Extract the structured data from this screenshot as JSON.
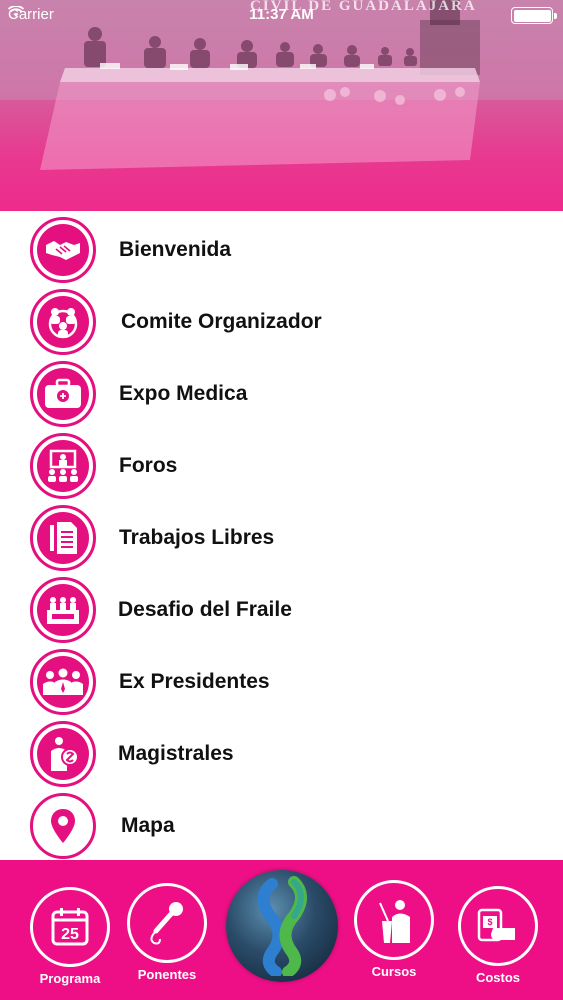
{
  "status_bar": {
    "carrier": "Carrier",
    "time": "11:37 AM"
  },
  "banner": {
    "text": "CIVIL DE GUADALAJARA"
  },
  "menu": {
    "items": [
      {
        "label": "Bienvenida",
        "icon": "handshake-icon"
      },
      {
        "label": "Comite Organizador",
        "icon": "people-group-icon"
      },
      {
        "label": "Expo Medica",
        "icon": "medical-briefcase-icon"
      },
      {
        "label": "Foros",
        "icon": "presentation-screen-icon"
      },
      {
        "label": "Trabajos Libres",
        "icon": "document-icon"
      },
      {
        "label": "Desafio del Fraile",
        "icon": "quiz-panel-icon"
      },
      {
        "label": "Ex Presidentes",
        "icon": "presidents-icon"
      },
      {
        "label": "Magistrales",
        "icon": "lecturer-icon"
      },
      {
        "label": "Mapa",
        "icon": "map-pin-icon"
      }
    ]
  },
  "tabbar": {
    "programa": {
      "label": "Programa",
      "date": "25"
    },
    "ponentes": {
      "label": "Ponentes"
    },
    "cursos": {
      "label": "Cursos"
    },
    "costos": {
      "label": "Costos"
    }
  },
  "colors": {
    "accent": "#e5107f",
    "tabbar": "#ee0f87",
    "banner_bottom": "#ee2b8c"
  }
}
